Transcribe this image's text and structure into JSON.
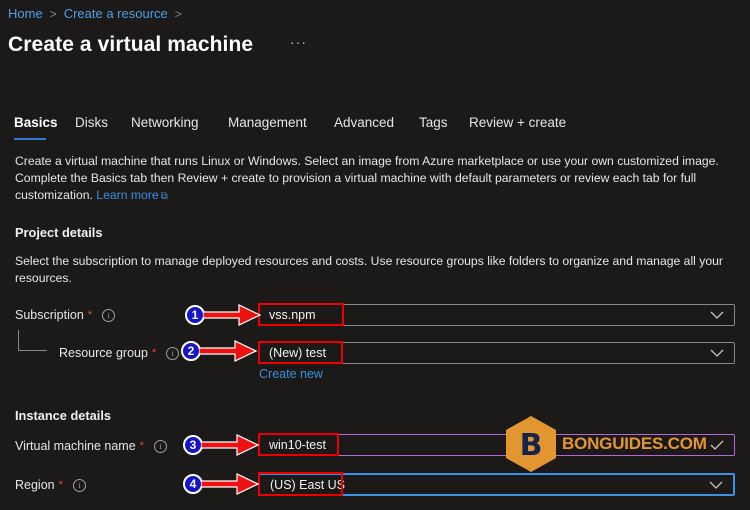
{
  "breadcrumb": {
    "items": [
      "Home",
      "Create a resource"
    ]
  },
  "header": {
    "title": "Create a virtual machine",
    "more_label": "···"
  },
  "tabs": [
    {
      "label": "Basics",
      "active": true
    },
    {
      "label": "Disks",
      "active": false
    },
    {
      "label": "Networking",
      "active": false
    },
    {
      "label": "Management",
      "active": false
    },
    {
      "label": "Advanced",
      "active": false
    },
    {
      "label": "Tags",
      "active": false
    },
    {
      "label": "Review + create",
      "active": false
    }
  ],
  "intro": {
    "text": "Create a virtual machine that runs Linux or Windows. Select an image from Azure marketplace or use your own customized image. Complete the Basics tab then Review + create to provision a virtual machine with default parameters or review each tab for full customization.",
    "learn_more": "Learn more",
    "learn_more_icon": "external-link-icon"
  },
  "project_details": {
    "title": "Project details",
    "description": "Select the subscription to manage deployed resources and costs. Use resource groups like folders to organize and manage all your resources.",
    "subscription": {
      "label": "Subscription",
      "required_mark": "*",
      "value": "vss.npm",
      "step": "1"
    },
    "resource_group": {
      "label": "Resource group",
      "required_mark": "*",
      "value": "(New) test",
      "step": "2",
      "create_new": "Create new"
    }
  },
  "instance_details": {
    "title": "Instance details",
    "vm_name": {
      "label": "Virtual machine name",
      "required_mark": "*",
      "value": "win10-test",
      "step": "3",
      "valid": true
    },
    "region": {
      "label": "Region",
      "required_mark": "*",
      "value": "(US) East US",
      "step": "4"
    }
  },
  "icons": {
    "info": "i"
  },
  "watermark": {
    "logo_letter": "B",
    "text": "BONGUIDES.COM",
    "color": "#e39532"
  },
  "colors": {
    "accent": "#2f7ad6",
    "link": "#3b8fe0",
    "highlight": "#ee0000",
    "badge": "#1414c8"
  }
}
